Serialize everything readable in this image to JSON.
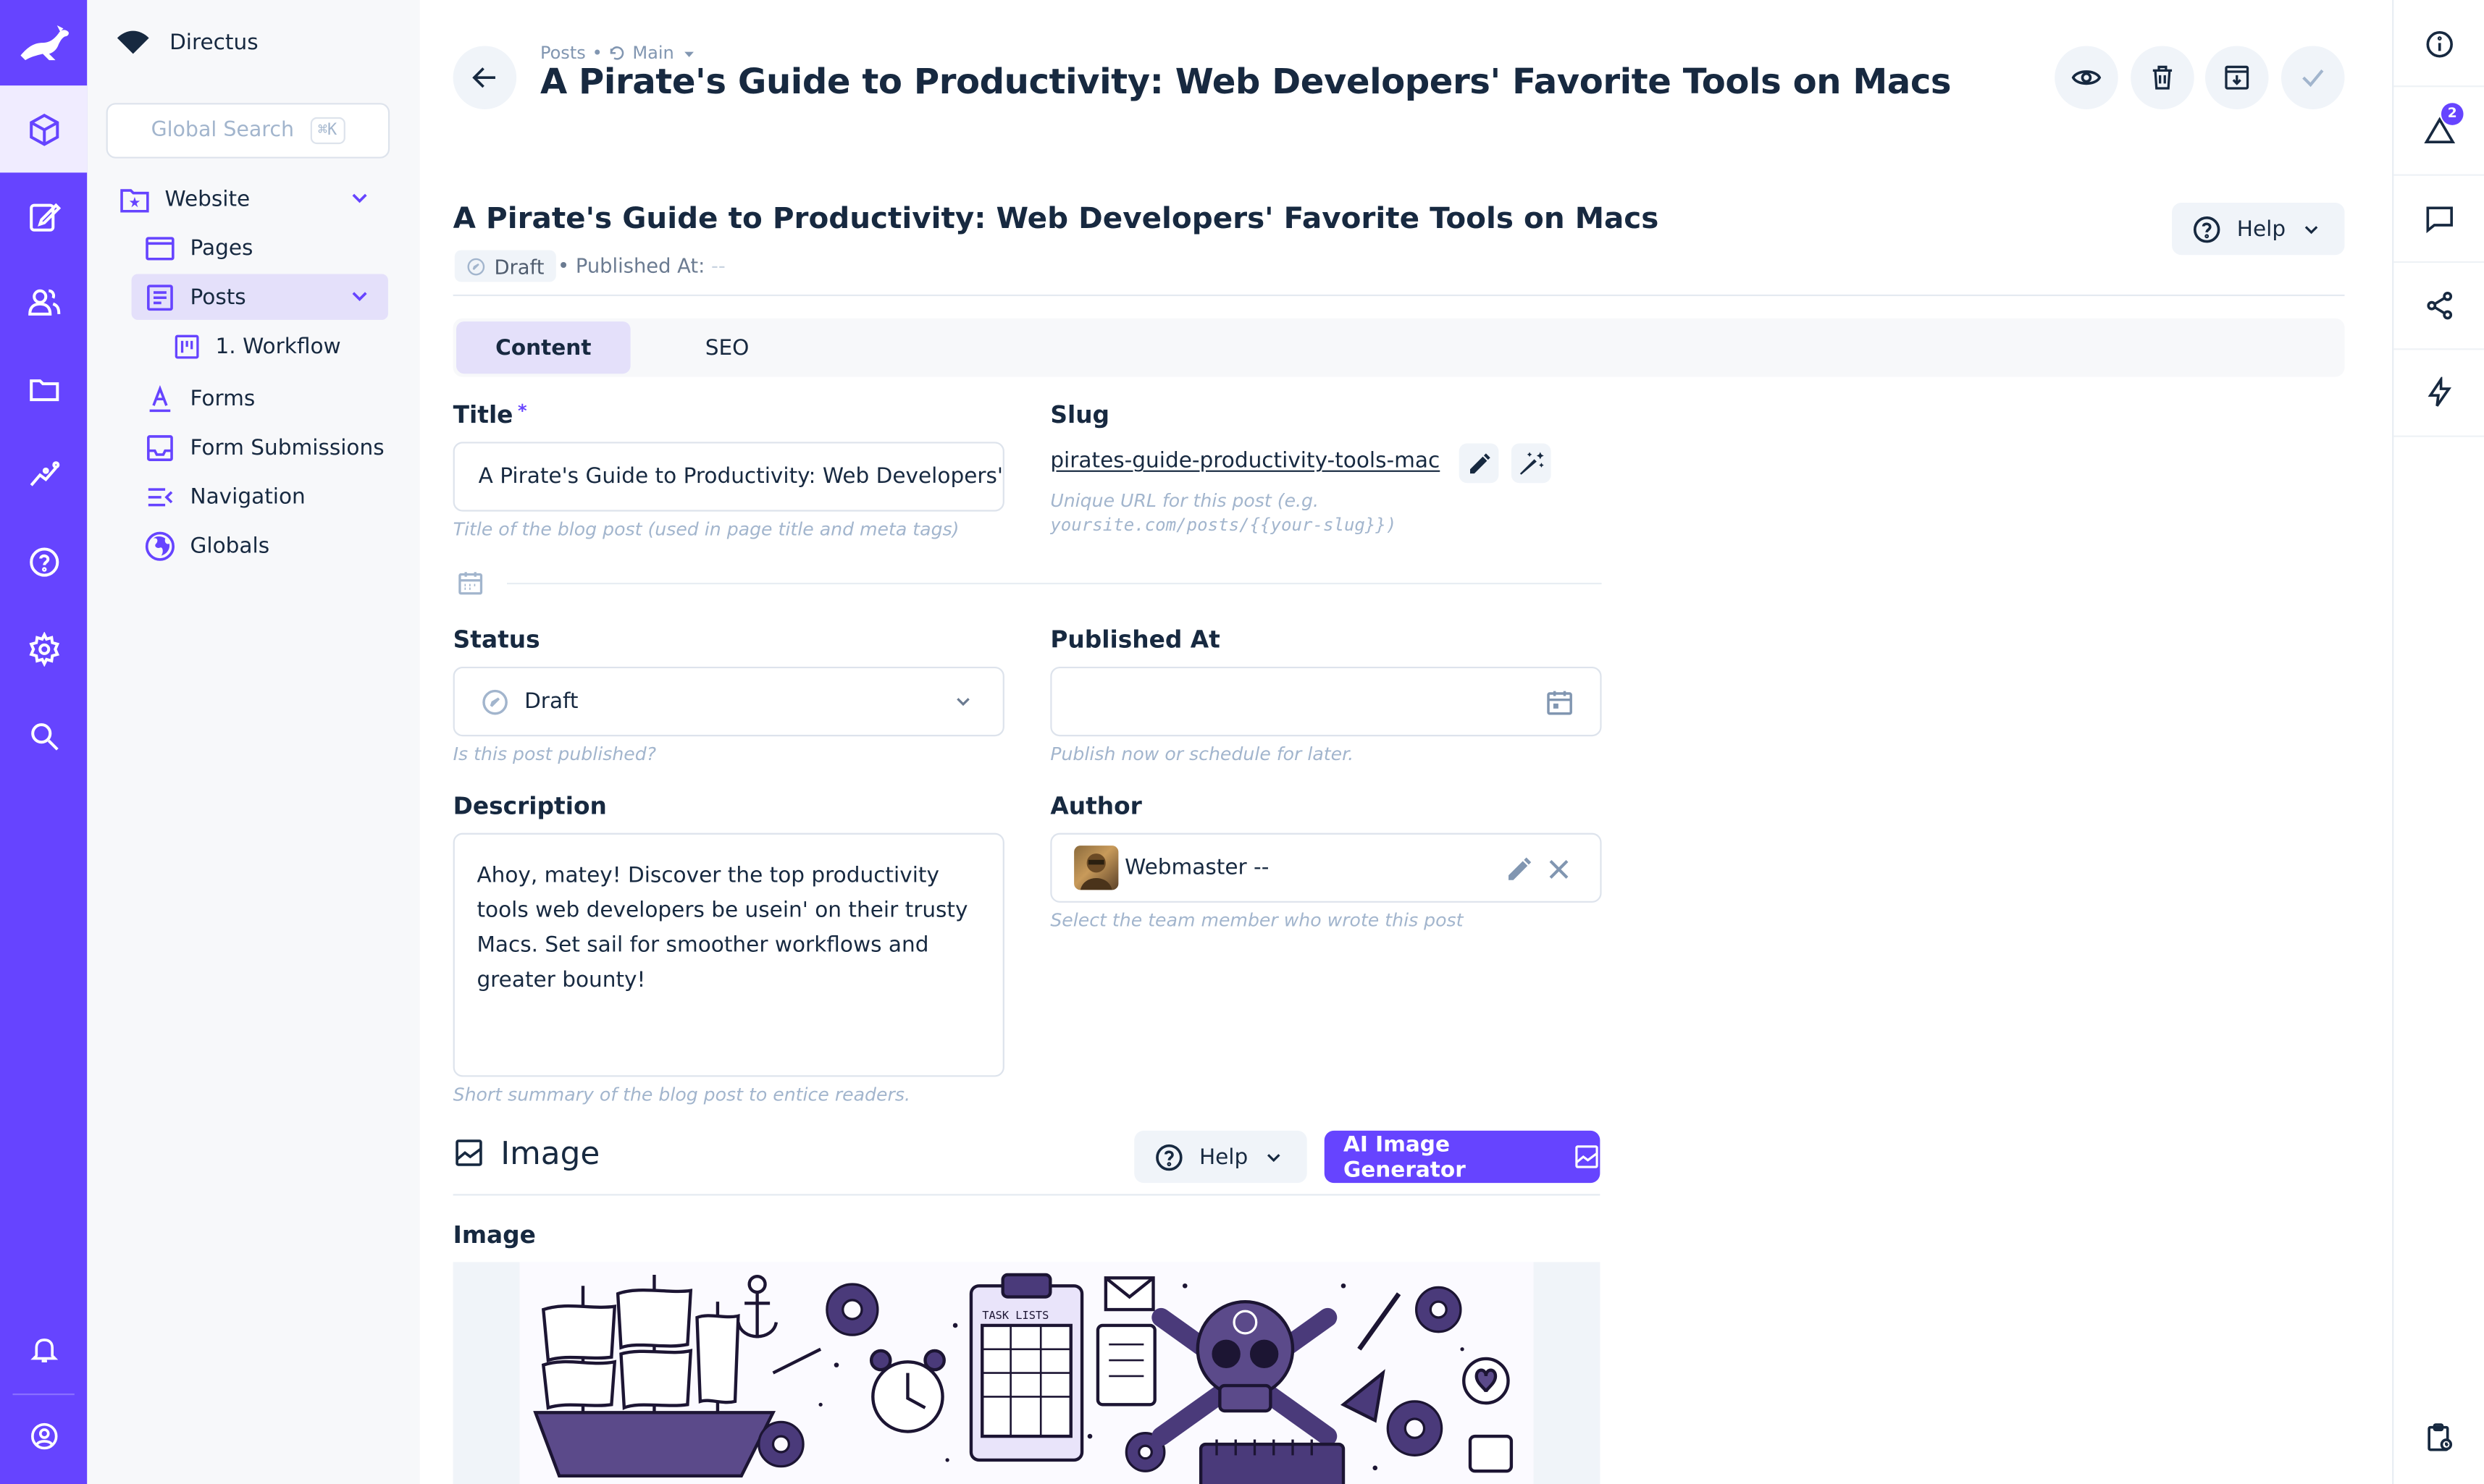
{
  "app": {
    "project_name": "Directus"
  },
  "nav": {
    "search_placeholder": "Global Search",
    "search_shortcut": "⌘K",
    "items": [
      {
        "label": "Website"
      },
      {
        "label": "Pages"
      },
      {
        "label": "Posts"
      },
      {
        "label": "1. Workflow"
      },
      {
        "label": "Forms"
      },
      {
        "label": "Form Submissions"
      },
      {
        "label": "Navigation"
      },
      {
        "label": "Globals"
      }
    ]
  },
  "header": {
    "breadcrumb_collection": "Posts",
    "breadcrumb_separator": "•",
    "breadcrumb_version": "Main",
    "title": "A Pirate's Guide to Productivity: Web Developers' Favorite Tools on Macs"
  },
  "right_sidebar": {
    "notification_count": "2"
  },
  "item": {
    "title": "A Pirate's Guide to Productivity: Web Developers' Favorite Tools on Macs",
    "status_chip": "Draft",
    "published_at_label": "• Published At:",
    "published_at_value": "--",
    "help_label": "Help"
  },
  "tabs": [
    {
      "label": "Content"
    },
    {
      "label": "SEO"
    }
  ],
  "form": {
    "title": {
      "label": "Title",
      "required": "*",
      "value": "A Pirate's Guide to Productivity: Web Developers'",
      "note": "Title of the blog post (used in page title and meta tags)"
    },
    "slug": {
      "label": "Slug",
      "value": "pirates-guide-productivity-tools-mac",
      "note_prefix": "Unique URL for this post (e.g.",
      "note_code": "yoursite.com/posts/{{your-slug}})"
    },
    "status": {
      "label": "Status",
      "value": "Draft",
      "note": "Is this post published?"
    },
    "published_at": {
      "label": "Published At",
      "value": "",
      "note": "Publish now or schedule for later."
    },
    "description": {
      "label": "Description",
      "value": "Ahoy, matey! Discover the top productivity tools web developers be usein' on their trusty Macs. Set sail for smoother workflows and greater bounty!",
      "note": "Short summary of the blog post to entice readers."
    },
    "author": {
      "label": "Author",
      "value": "Webmaster --",
      "note": "Select the team member who wrote this post"
    },
    "image_section": {
      "title": "Image",
      "help_label": "Help",
      "ai_button": "AI Image Generator"
    },
    "image_field": {
      "label": "Image",
      "illustration_text": "TASK LISTS"
    }
  },
  "colors": {
    "accent": "#6644ff",
    "accent_light": "#e4e0fa",
    "text": "#172940",
    "muted": "#a2b5cd"
  }
}
